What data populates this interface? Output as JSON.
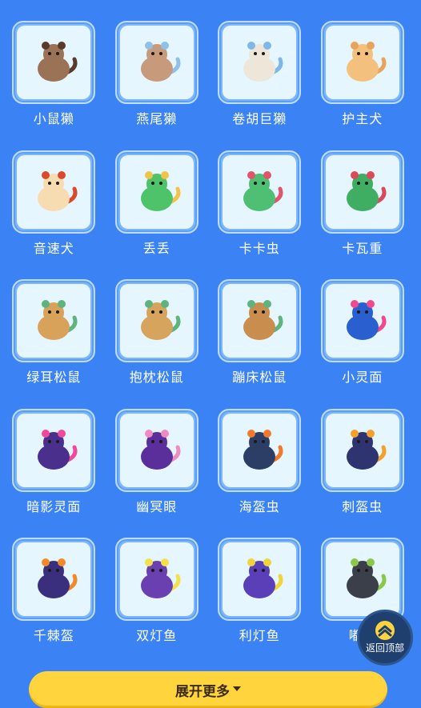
{
  "creatures": [
    {
      "name": "小鼠獭",
      "icon": "creature-small-otter",
      "color": "#9a7256",
      "accent": "#5a3a2a"
    },
    {
      "name": "燕尾獭",
      "icon": "creature-swallowtail-otter",
      "color": "#c79a7c",
      "accent": "#8fc0e8"
    },
    {
      "name": "卷胡巨獭",
      "icon": "creature-curly-beard-otter",
      "color": "#eee6d8",
      "accent": "#7fb8e8"
    },
    {
      "name": "护主犬",
      "icon": "creature-guard-dog",
      "color": "#f3c07e",
      "accent": "#e8a45c"
    },
    {
      "name": "音速犬",
      "icon": "creature-sonic-dog",
      "color": "#f6dcb0",
      "accent": "#d84a2a"
    },
    {
      "name": "丢丢",
      "icon": "creature-diudiu",
      "color": "#4ec36a",
      "accent": "#f0c44a"
    },
    {
      "name": "卡卡虫",
      "icon": "creature-kaka-bug",
      "color": "#4fbf74",
      "accent": "#e0556a"
    },
    {
      "name": "卡瓦重",
      "icon": "creature-kawa-heavy",
      "color": "#3fae62",
      "accent": "#d94a5c"
    },
    {
      "name": "绿耳松鼠",
      "icon": "creature-green-ear-squirrel",
      "color": "#d9a25a",
      "accent": "#5fb37c"
    },
    {
      "name": "抱枕松鼠",
      "icon": "creature-pillow-squirrel",
      "color": "#d6a45c",
      "accent": "#5fb37c"
    },
    {
      "name": "蹦床松鼠",
      "icon": "creature-trampoline-squirrel",
      "color": "#c98d4e",
      "accent": "#5fb37c"
    },
    {
      "name": "小灵面",
      "icon": "creature-little-spirit-mask",
      "color": "#2a5fd0",
      "accent": "#f04a8c"
    },
    {
      "name": "暗影灵面",
      "icon": "creature-shadow-spirit-mask",
      "color": "#4a2f8c",
      "accent": "#f04a9c"
    },
    {
      "name": "幽冥眼",
      "icon": "creature-nether-eye",
      "color": "#5a2f9c",
      "accent": "#f08ac4"
    },
    {
      "name": "海盔虫",
      "icon": "creature-sea-helmet-bug",
      "color": "#2c3e66",
      "accent": "#f07a2a"
    },
    {
      "name": "刺盔虫",
      "icon": "creature-spike-helmet-bug",
      "color": "#2e3470",
      "accent": "#f4a02a"
    },
    {
      "name": "千棘盔",
      "icon": "creature-thousand-thorn-helmet",
      "color": "#3a2f7c",
      "accent": "#f08a2a"
    },
    {
      "name": "双灯鱼",
      "icon": "creature-twin-lantern-fish",
      "color": "#6a3fb0",
      "accent": "#f4e04a"
    },
    {
      "name": "利灯鱼",
      "icon": "creature-sharp-lantern-fish",
      "color": "#5a3fb8",
      "accent": "#f0d43a"
    },
    {
      "name": "嘟嘟",
      "icon": "creature-dudu",
      "color": "#3a3f4a",
      "accent": "#8ac84a"
    }
  ],
  "expand_button": {
    "label": "展开更多"
  },
  "back_to_top": {
    "label": "返回顶部"
  },
  "colors": {
    "background": "#3b83f4",
    "button": "#ffd43c",
    "card": "#e5f6fe"
  }
}
